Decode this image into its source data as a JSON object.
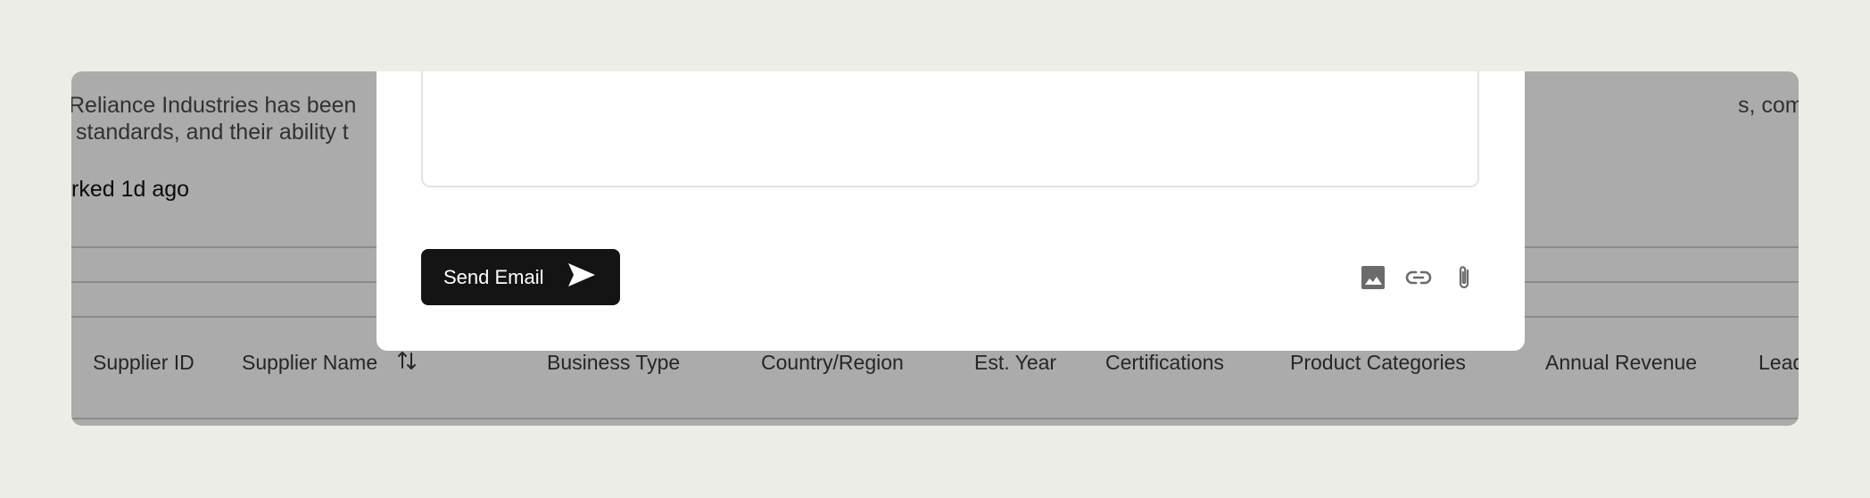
{
  "background": {
    "description_line1_left": "Reliance Industries has been",
    "description_line1_right": "s, compliance with",
    "description_line2": "standards, and their ability t",
    "marked_text": "rked 1d ago"
  },
  "table": {
    "columns": [
      "Supplier ID",
      "Supplier Name",
      "Business Type",
      "Country/Region",
      "Est. Year",
      "Certifications",
      "Product Categories",
      "Annual Revenue",
      "Lead"
    ]
  },
  "modal": {
    "send_label": "Send Email",
    "icons": [
      "image-icon",
      "link-icon",
      "paperclip-icon",
      "send-arrow-icon",
      "sort-icon"
    ]
  },
  "colors": {
    "page_bg": "#edede7",
    "button_bg": "#141414",
    "overlay": "rgba(0,0,0,0.33)"
  }
}
